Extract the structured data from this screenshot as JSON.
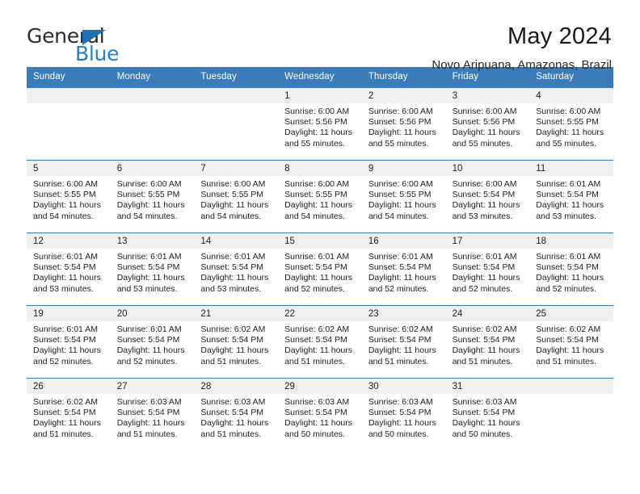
{
  "brand": {
    "logo_general": "General",
    "logo_blue": "Blue",
    "triangle_color": "#1f6fb5",
    "blue_text_color": "#1f7fd0"
  },
  "header": {
    "title": "May 2024",
    "subtitle": "Novo Aripuana, Amazonas, Brazil"
  },
  "theme": {
    "header_band": "#3a7cba",
    "daynum_band": "#f0f0f0",
    "text": "#222222",
    "page_background": "#ffffff"
  },
  "weekdays": [
    "Sunday",
    "Monday",
    "Tuesday",
    "Wednesday",
    "Thursday",
    "Friday",
    "Saturday"
  ],
  "weeks": [
    [
      {
        "day": "",
        "empty": true,
        "lines": []
      },
      {
        "day": "",
        "empty": true,
        "lines": []
      },
      {
        "day": "",
        "empty": true,
        "lines": []
      },
      {
        "day": "1",
        "empty": false,
        "lines": [
          "Sunrise: 6:00 AM",
          "Sunset: 5:56 PM",
          "Daylight: 11 hours",
          "and 55 minutes."
        ]
      },
      {
        "day": "2",
        "empty": false,
        "lines": [
          "Sunrise: 6:00 AM",
          "Sunset: 5:56 PM",
          "Daylight: 11 hours",
          "and 55 minutes."
        ]
      },
      {
        "day": "3",
        "empty": false,
        "lines": [
          "Sunrise: 6:00 AM",
          "Sunset: 5:56 PM",
          "Daylight: 11 hours",
          "and 55 minutes."
        ]
      },
      {
        "day": "4",
        "empty": false,
        "lines": [
          "Sunrise: 6:00 AM",
          "Sunset: 5:55 PM",
          "Daylight: 11 hours",
          "and 55 minutes."
        ]
      }
    ],
    [
      {
        "day": "5",
        "empty": false,
        "lines": [
          "Sunrise: 6:00 AM",
          "Sunset: 5:55 PM",
          "Daylight: 11 hours",
          "and 54 minutes."
        ]
      },
      {
        "day": "6",
        "empty": false,
        "lines": [
          "Sunrise: 6:00 AM",
          "Sunset: 5:55 PM",
          "Daylight: 11 hours",
          "and 54 minutes."
        ]
      },
      {
        "day": "7",
        "empty": false,
        "lines": [
          "Sunrise: 6:00 AM",
          "Sunset: 5:55 PM",
          "Daylight: 11 hours",
          "and 54 minutes."
        ]
      },
      {
        "day": "8",
        "empty": false,
        "lines": [
          "Sunrise: 6:00 AM",
          "Sunset: 5:55 PM",
          "Daylight: 11 hours",
          "and 54 minutes."
        ]
      },
      {
        "day": "9",
        "empty": false,
        "lines": [
          "Sunrise: 6:00 AM",
          "Sunset: 5:55 PM",
          "Daylight: 11 hours",
          "and 54 minutes."
        ]
      },
      {
        "day": "10",
        "empty": false,
        "lines": [
          "Sunrise: 6:00 AM",
          "Sunset: 5:54 PM",
          "Daylight: 11 hours",
          "and 53 minutes."
        ]
      },
      {
        "day": "11",
        "empty": false,
        "lines": [
          "Sunrise: 6:01 AM",
          "Sunset: 5:54 PM",
          "Daylight: 11 hours",
          "and 53 minutes."
        ]
      }
    ],
    [
      {
        "day": "12",
        "empty": false,
        "lines": [
          "Sunrise: 6:01 AM",
          "Sunset: 5:54 PM",
          "Daylight: 11 hours",
          "and 53 minutes."
        ]
      },
      {
        "day": "13",
        "empty": false,
        "lines": [
          "Sunrise: 6:01 AM",
          "Sunset: 5:54 PM",
          "Daylight: 11 hours",
          "and 53 minutes."
        ]
      },
      {
        "day": "14",
        "empty": false,
        "lines": [
          "Sunrise: 6:01 AM",
          "Sunset: 5:54 PM",
          "Daylight: 11 hours",
          "and 53 minutes."
        ]
      },
      {
        "day": "15",
        "empty": false,
        "lines": [
          "Sunrise: 6:01 AM",
          "Sunset: 5:54 PM",
          "Daylight: 11 hours",
          "and 52 minutes."
        ]
      },
      {
        "day": "16",
        "empty": false,
        "lines": [
          "Sunrise: 6:01 AM",
          "Sunset: 5:54 PM",
          "Daylight: 11 hours",
          "and 52 minutes."
        ]
      },
      {
        "day": "17",
        "empty": false,
        "lines": [
          "Sunrise: 6:01 AM",
          "Sunset: 5:54 PM",
          "Daylight: 11 hours",
          "and 52 minutes."
        ]
      },
      {
        "day": "18",
        "empty": false,
        "lines": [
          "Sunrise: 6:01 AM",
          "Sunset: 5:54 PM",
          "Daylight: 11 hours",
          "and 52 minutes."
        ]
      }
    ],
    [
      {
        "day": "19",
        "empty": false,
        "lines": [
          "Sunrise: 6:01 AM",
          "Sunset: 5:54 PM",
          "Daylight: 11 hours",
          "and 52 minutes."
        ]
      },
      {
        "day": "20",
        "empty": false,
        "lines": [
          "Sunrise: 6:01 AM",
          "Sunset: 5:54 PM",
          "Daylight: 11 hours",
          "and 52 minutes."
        ]
      },
      {
        "day": "21",
        "empty": false,
        "lines": [
          "Sunrise: 6:02 AM",
          "Sunset: 5:54 PM",
          "Daylight: 11 hours",
          "and 51 minutes."
        ]
      },
      {
        "day": "22",
        "empty": false,
        "lines": [
          "Sunrise: 6:02 AM",
          "Sunset: 5:54 PM",
          "Daylight: 11 hours",
          "and 51 minutes."
        ]
      },
      {
        "day": "23",
        "empty": false,
        "lines": [
          "Sunrise: 6:02 AM",
          "Sunset: 5:54 PM",
          "Daylight: 11 hours",
          "and 51 minutes."
        ]
      },
      {
        "day": "24",
        "empty": false,
        "lines": [
          "Sunrise: 6:02 AM",
          "Sunset: 5:54 PM",
          "Daylight: 11 hours",
          "and 51 minutes."
        ]
      },
      {
        "day": "25",
        "empty": false,
        "lines": [
          "Sunrise: 6:02 AM",
          "Sunset: 5:54 PM",
          "Daylight: 11 hours",
          "and 51 minutes."
        ]
      }
    ],
    [
      {
        "day": "26",
        "empty": false,
        "lines": [
          "Sunrise: 6:02 AM",
          "Sunset: 5:54 PM",
          "Daylight: 11 hours",
          "and 51 minutes."
        ]
      },
      {
        "day": "27",
        "empty": false,
        "lines": [
          "Sunrise: 6:03 AM",
          "Sunset: 5:54 PM",
          "Daylight: 11 hours",
          "and 51 minutes."
        ]
      },
      {
        "day": "28",
        "empty": false,
        "lines": [
          "Sunrise: 6:03 AM",
          "Sunset: 5:54 PM",
          "Daylight: 11 hours",
          "and 51 minutes."
        ]
      },
      {
        "day": "29",
        "empty": false,
        "lines": [
          "Sunrise: 6:03 AM",
          "Sunset: 5:54 PM",
          "Daylight: 11 hours",
          "and 50 minutes."
        ]
      },
      {
        "day": "30",
        "empty": false,
        "lines": [
          "Sunrise: 6:03 AM",
          "Sunset: 5:54 PM",
          "Daylight: 11 hours",
          "and 50 minutes."
        ]
      },
      {
        "day": "31",
        "empty": false,
        "lines": [
          "Sunrise: 6:03 AM",
          "Sunset: 5:54 PM",
          "Daylight: 11 hours",
          "and 50 minutes."
        ]
      },
      {
        "day": "",
        "empty": true,
        "lines": []
      }
    ]
  ]
}
